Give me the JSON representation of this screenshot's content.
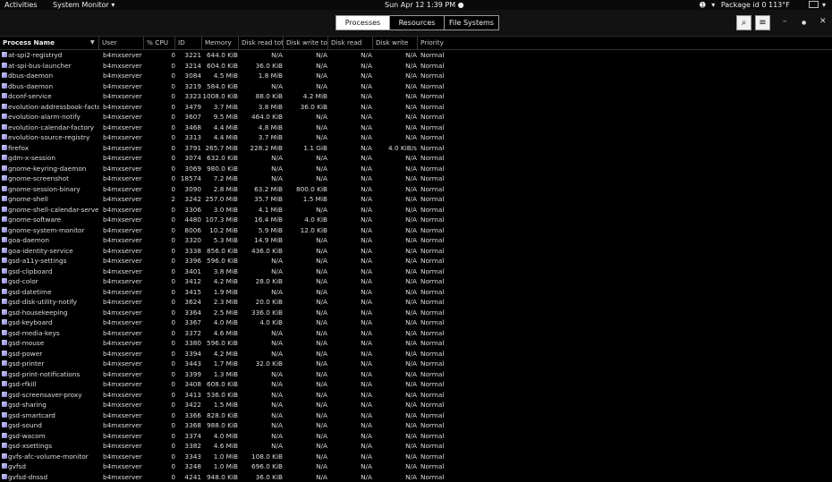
{
  "topbar": {
    "activities": "Activities",
    "app_menu": "System Monitor ▾",
    "clock": "Sun Apr 12   1:39 PM ●",
    "tray_text": "Package id 0 113°F"
  },
  "tabs": [
    {
      "label": "Processes",
      "active": true
    },
    {
      "label": "Resources",
      "active": false
    },
    {
      "label": "File Systems",
      "active": false
    }
  ],
  "header_buttons": {
    "search": "⌕",
    "menu": "≡",
    "minimize": "–",
    "maximize": "●",
    "close": "✕"
  },
  "columns": [
    "Process Name",
    "User",
    "% CPU",
    "ID",
    "Memory",
    "Disk read total",
    "Disk write total",
    "Disk read",
    "Disk write",
    "Priority"
  ],
  "processes": [
    {
      "name": "at-spi2-registryd",
      "user": "b4mxserver",
      "cpu": "0",
      "id": "3221",
      "mem": "644.0 KiB",
      "dread": "N/A",
      "dwrite": "N/A",
      "dread2": "N/A",
      "dwrite2": "N/A",
      "prio": "Normal"
    },
    {
      "name": "at-spi-bus-launcher",
      "user": "b4mxserver",
      "cpu": "0",
      "id": "3214",
      "mem": "604.0 KiB",
      "dread": "36.0 KiB",
      "dwrite": "N/A",
      "dread2": "N/A",
      "dwrite2": "N/A",
      "prio": "Normal"
    },
    {
      "name": "dbus-daemon",
      "user": "b4mxserver",
      "cpu": "0",
      "id": "3084",
      "mem": "4.5 MiB",
      "dread": "1.8 MiB",
      "dwrite": "N/A",
      "dread2": "N/A",
      "dwrite2": "N/A",
      "prio": "Normal"
    },
    {
      "name": "dbus-daemon",
      "user": "b4mxserver",
      "cpu": "0",
      "id": "3219",
      "mem": "584.0 KiB",
      "dread": "N/A",
      "dwrite": "N/A",
      "dread2": "N/A",
      "dwrite2": "N/A",
      "prio": "Normal"
    },
    {
      "name": "dconf-service",
      "user": "b4mxserver",
      "cpu": "0",
      "id": "3323",
      "mem": "1008.0 KiB",
      "dread": "88.0 KiB",
      "dwrite": "4.2 MiB",
      "dread2": "N/A",
      "dwrite2": "N/A",
      "prio": "Normal"
    },
    {
      "name": "evolution-addressbook-factory",
      "user": "b4mxserver",
      "cpu": "0",
      "id": "3479",
      "mem": "3.7 MiB",
      "dread": "3.8 MiB",
      "dwrite": "36.0 KiB",
      "dread2": "N/A",
      "dwrite2": "N/A",
      "prio": "Normal"
    },
    {
      "name": "evolution-alarm-notify",
      "user": "b4mxserver",
      "cpu": "0",
      "id": "3607",
      "mem": "9.5 MiB",
      "dread": "464.0 KiB",
      "dwrite": "N/A",
      "dread2": "N/A",
      "dwrite2": "N/A",
      "prio": "Normal"
    },
    {
      "name": "evolution-calendar-factory",
      "user": "b4mxserver",
      "cpu": "0",
      "id": "3468",
      "mem": "4.4 MiB",
      "dread": "4.8 MiB",
      "dwrite": "N/A",
      "dread2": "N/A",
      "dwrite2": "N/A",
      "prio": "Normal"
    },
    {
      "name": "evolution-source-registry",
      "user": "b4mxserver",
      "cpu": "0",
      "id": "3313",
      "mem": "4.4 MiB",
      "dread": "3.7 MiB",
      "dwrite": "N/A",
      "dread2": "N/A",
      "dwrite2": "N/A",
      "prio": "Normal"
    },
    {
      "name": "firefox",
      "user": "b4mxserver",
      "cpu": "0",
      "id": "3791",
      "mem": "265.7 MiB",
      "dread": "228.2 MiB",
      "dwrite": "1.1 GiB",
      "dread2": "N/A",
      "dwrite2": "4.0 KiB/s",
      "prio": "Normal"
    },
    {
      "name": "gdm-x-session",
      "user": "b4mxserver",
      "cpu": "0",
      "id": "3074",
      "mem": "632.0 KiB",
      "dread": "N/A",
      "dwrite": "N/A",
      "dread2": "N/A",
      "dwrite2": "N/A",
      "prio": "Normal"
    },
    {
      "name": "gnome-keyring-daemon",
      "user": "b4mxserver",
      "cpu": "0",
      "id": "3069",
      "mem": "980.0 KiB",
      "dread": "N/A",
      "dwrite": "N/A",
      "dread2": "N/A",
      "dwrite2": "N/A",
      "prio": "Normal"
    },
    {
      "name": "gnome-screenshot",
      "user": "b4mxserver",
      "cpu": "0",
      "id": "18574",
      "mem": "7.2 MiB",
      "dread": "N/A",
      "dwrite": "N/A",
      "dread2": "N/A",
      "dwrite2": "N/A",
      "prio": "Normal"
    },
    {
      "name": "gnome-session-binary",
      "user": "b4mxserver",
      "cpu": "0",
      "id": "3090",
      "mem": "2.8 MiB",
      "dread": "63.2 MiB",
      "dwrite": "800.0 KiB",
      "dread2": "N/A",
      "dwrite2": "N/A",
      "prio": "Normal"
    },
    {
      "name": "gnome-shell",
      "user": "b4mxserver",
      "cpu": "2",
      "id": "3242",
      "mem": "257.0 MiB",
      "dread": "35.7 MiB",
      "dwrite": "1.5 MiB",
      "dread2": "N/A",
      "dwrite2": "N/A",
      "prio": "Normal"
    },
    {
      "name": "gnome-shell-calendar-server",
      "user": "b4mxserver",
      "cpu": "0",
      "id": "3306",
      "mem": "3.0 MiB",
      "dread": "4.1 MiB",
      "dwrite": "N/A",
      "dread2": "N/A",
      "dwrite2": "N/A",
      "prio": "Normal"
    },
    {
      "name": "gnome-software",
      "user": "b4mxserver",
      "cpu": "0",
      "id": "4480",
      "mem": "107.3 MiB",
      "dread": "16.4 MiB",
      "dwrite": "4.0 KiB",
      "dread2": "N/A",
      "dwrite2": "N/A",
      "prio": "Normal"
    },
    {
      "name": "gnome-system-monitor",
      "user": "b4mxserver",
      "cpu": "0",
      "id": "8006",
      "mem": "10.2 MiB",
      "dread": "5.9 MiB",
      "dwrite": "12.0 KiB",
      "dread2": "N/A",
      "dwrite2": "N/A",
      "prio": "Normal"
    },
    {
      "name": "goa-daemon",
      "user": "b4mxserver",
      "cpu": "0",
      "id": "3320",
      "mem": "5.3 MiB",
      "dread": "14.9 MiB",
      "dwrite": "N/A",
      "dread2": "N/A",
      "dwrite2": "N/A",
      "prio": "Normal"
    },
    {
      "name": "goa-identity-service",
      "user": "b4mxserver",
      "cpu": "0",
      "id": "3338",
      "mem": "856.0 KiB",
      "dread": "436.0 KiB",
      "dwrite": "N/A",
      "dread2": "N/A",
      "dwrite2": "N/A",
      "prio": "Normal"
    },
    {
      "name": "gsd-a11y-settings",
      "user": "b4mxserver",
      "cpu": "0",
      "id": "3396",
      "mem": "596.0 KiB",
      "dread": "N/A",
      "dwrite": "N/A",
      "dread2": "N/A",
      "dwrite2": "N/A",
      "prio": "Normal"
    },
    {
      "name": "gsd-clipboard",
      "user": "b4mxserver",
      "cpu": "0",
      "id": "3401",
      "mem": "3.8 MiB",
      "dread": "N/A",
      "dwrite": "N/A",
      "dread2": "N/A",
      "dwrite2": "N/A",
      "prio": "Normal"
    },
    {
      "name": "gsd-color",
      "user": "b4mxserver",
      "cpu": "0",
      "id": "3412",
      "mem": "4.2 MiB",
      "dread": "28.0 KiB",
      "dwrite": "N/A",
      "dread2": "N/A",
      "dwrite2": "N/A",
      "prio": "Normal"
    },
    {
      "name": "gsd-datetime",
      "user": "b4mxserver",
      "cpu": "0",
      "id": "3415",
      "mem": "1.9 MiB",
      "dread": "N/A",
      "dwrite": "N/A",
      "dread2": "N/A",
      "dwrite2": "N/A",
      "prio": "Normal"
    },
    {
      "name": "gsd-disk-utility-notify",
      "user": "b4mxserver",
      "cpu": "0",
      "id": "3624",
      "mem": "2.3 MiB",
      "dread": "20.0 KiB",
      "dwrite": "N/A",
      "dread2": "N/A",
      "dwrite2": "N/A",
      "prio": "Normal"
    },
    {
      "name": "gsd-housekeeping",
      "user": "b4mxserver",
      "cpu": "0",
      "id": "3364",
      "mem": "2.5 MiB",
      "dread": "336.0 KiB",
      "dwrite": "N/A",
      "dread2": "N/A",
      "dwrite2": "N/A",
      "prio": "Normal"
    },
    {
      "name": "gsd-keyboard",
      "user": "b4mxserver",
      "cpu": "0",
      "id": "3367",
      "mem": "4.0 MiB",
      "dread": "4.0 KiB",
      "dwrite": "N/A",
      "dread2": "N/A",
      "dwrite2": "N/A",
      "prio": "Normal"
    },
    {
      "name": "gsd-media-keys",
      "user": "b4mxserver",
      "cpu": "0",
      "id": "3372",
      "mem": "4.6 MiB",
      "dread": "N/A",
      "dwrite": "N/A",
      "dread2": "N/A",
      "dwrite2": "N/A",
      "prio": "Normal"
    },
    {
      "name": "gsd-mouse",
      "user": "b4mxserver",
      "cpu": "0",
      "id": "3380",
      "mem": "596.0 KiB",
      "dread": "N/A",
      "dwrite": "N/A",
      "dread2": "N/A",
      "dwrite2": "N/A",
      "prio": "Normal"
    },
    {
      "name": "gsd-power",
      "user": "b4mxserver",
      "cpu": "0",
      "id": "3394",
      "mem": "4.2 MiB",
      "dread": "N/A",
      "dwrite": "N/A",
      "dread2": "N/A",
      "dwrite2": "N/A",
      "prio": "Normal"
    },
    {
      "name": "gsd-printer",
      "user": "b4mxserver",
      "cpu": "0",
      "id": "3443",
      "mem": "1.7 MiB",
      "dread": "32.0 KiB",
      "dwrite": "N/A",
      "dread2": "N/A",
      "dwrite2": "N/A",
      "prio": "Normal"
    },
    {
      "name": "gsd-print-notifications",
      "user": "b4mxserver",
      "cpu": "0",
      "id": "3399",
      "mem": "1.3 MiB",
      "dread": "N/A",
      "dwrite": "N/A",
      "dread2": "N/A",
      "dwrite2": "N/A",
      "prio": "Normal"
    },
    {
      "name": "gsd-rfkill",
      "user": "b4mxserver",
      "cpu": "0",
      "id": "3408",
      "mem": "608.0 KiB",
      "dread": "N/A",
      "dwrite": "N/A",
      "dread2": "N/A",
      "dwrite2": "N/A",
      "prio": "Normal"
    },
    {
      "name": "gsd-screensaver-proxy",
      "user": "b4mxserver",
      "cpu": "0",
      "id": "3413",
      "mem": "536.0 KiB",
      "dread": "N/A",
      "dwrite": "N/A",
      "dread2": "N/A",
      "dwrite2": "N/A",
      "prio": "Normal"
    },
    {
      "name": "gsd-sharing",
      "user": "b4mxserver",
      "cpu": "0",
      "id": "3422",
      "mem": "1.5 MiB",
      "dread": "N/A",
      "dwrite": "N/A",
      "dread2": "N/A",
      "dwrite2": "N/A",
      "prio": "Normal"
    },
    {
      "name": "gsd-smartcard",
      "user": "b4mxserver",
      "cpu": "0",
      "id": "3366",
      "mem": "828.0 KiB",
      "dread": "N/A",
      "dwrite": "N/A",
      "dread2": "N/A",
      "dwrite2": "N/A",
      "prio": "Normal"
    },
    {
      "name": "gsd-sound",
      "user": "b4mxserver",
      "cpu": "0",
      "id": "3368",
      "mem": "988.0 KiB",
      "dread": "N/A",
      "dwrite": "N/A",
      "dread2": "N/A",
      "dwrite2": "N/A",
      "prio": "Normal"
    },
    {
      "name": "gsd-wacom",
      "user": "b4mxserver",
      "cpu": "0",
      "id": "3374",
      "mem": "4.0 MiB",
      "dread": "N/A",
      "dwrite": "N/A",
      "dread2": "N/A",
      "dwrite2": "N/A",
      "prio": "Normal"
    },
    {
      "name": "gsd-xsettings",
      "user": "b4mxserver",
      "cpu": "0",
      "id": "3382",
      "mem": "4.6 MiB",
      "dread": "N/A",
      "dwrite": "N/A",
      "dread2": "N/A",
      "dwrite2": "N/A",
      "prio": "Normal"
    },
    {
      "name": "gvfs-afc-volume-monitor",
      "user": "b4mxserver",
      "cpu": "0",
      "id": "3343",
      "mem": "1.0 MiB",
      "dread": "108.0 KiB",
      "dwrite": "N/A",
      "dread2": "N/A",
      "dwrite2": "N/A",
      "prio": "Normal"
    },
    {
      "name": "gvfsd",
      "user": "b4mxserver",
      "cpu": "0",
      "id": "3248",
      "mem": "1.0 MiB",
      "dread": "696.0 KiB",
      "dwrite": "N/A",
      "dread2": "N/A",
      "dwrite2": "N/A",
      "prio": "Normal"
    },
    {
      "name": "gvfsd-dnssd",
      "user": "b4mxserver",
      "cpu": "0",
      "id": "4241",
      "mem": "948.0 KiB",
      "dread": "36.0 KiB",
      "dwrite": "N/A",
      "dread2": "N/A",
      "dwrite2": "N/A",
      "prio": "Normal"
    }
  ]
}
